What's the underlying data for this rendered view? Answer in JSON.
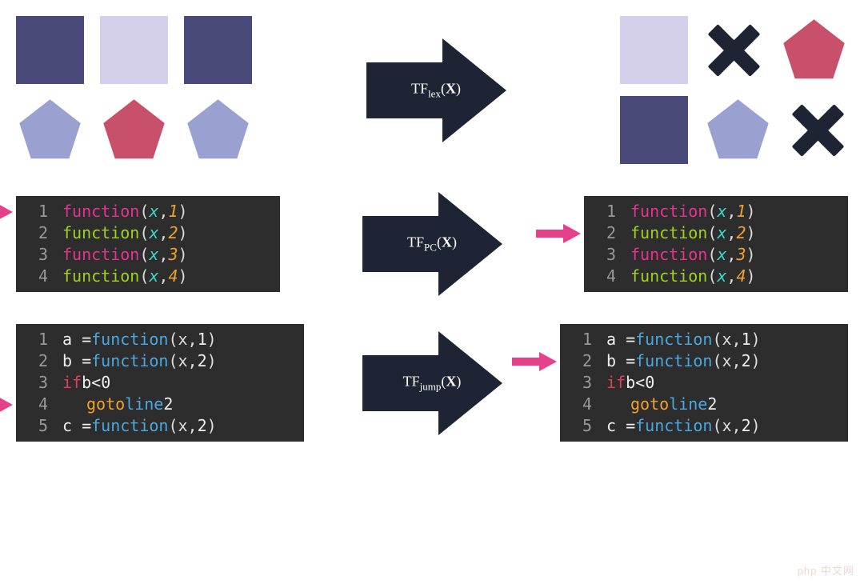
{
  "colors": {
    "darkPurple": "#4a4a7a",
    "lightLavender": "#d4d0ec",
    "bluePurple": "#9aa0d0",
    "rose": "#c8506a",
    "darkNavy": "#1e2433",
    "codeBg": "#2d2d2d",
    "arrowPink": "#e6408a"
  },
  "row1": {
    "label_prefix": "TF",
    "label_sub": "lex",
    "label_arg": "X",
    "left": {
      "top": [
        {
          "shape": "square",
          "color": "darkPurple"
        },
        {
          "shape": "square",
          "color": "lightLavender"
        },
        {
          "shape": "square",
          "color": "darkPurple"
        }
      ],
      "bottom": [
        {
          "shape": "pentagon",
          "color": "bluePurple"
        },
        {
          "shape": "pentagon",
          "color": "rose"
        },
        {
          "shape": "pentagon",
          "color": "bluePurple"
        }
      ]
    },
    "right": {
      "top": [
        {
          "shape": "square",
          "color": "lightLavender"
        },
        {
          "shape": "x",
          "color": "darkNavy"
        },
        {
          "shape": "pentagon",
          "color": "rose"
        }
      ],
      "bottom": [
        {
          "shape": "square",
          "color": "darkPurple"
        },
        {
          "shape": "pentagon",
          "color": "bluePurple"
        },
        {
          "shape": "x",
          "color": "darkNavy"
        }
      ]
    }
  },
  "row2": {
    "label_prefix": "TF",
    "label_sub": "PC",
    "label_arg": "X",
    "left_pointer_line": 1,
    "right_pointer_line": 2,
    "left_code": [
      {
        "n": "1",
        "fn_color": "pink",
        "fn": "function",
        "var": "x",
        "var_style": "teal",
        "arg": "1",
        "arg_style": "orange"
      },
      {
        "n": "2",
        "fn_color": "green",
        "fn": "function",
        "var": "x",
        "var_style": "teal",
        "arg": "2",
        "arg_style": "orange"
      },
      {
        "n": "3",
        "fn_color": "pink",
        "fn": "function",
        "var": "x",
        "var_style": "teal",
        "arg": "3",
        "arg_style": "orange"
      },
      {
        "n": "4",
        "fn_color": "green",
        "fn": "function",
        "var": "x",
        "var_style": "teal",
        "arg": "4",
        "arg_style": "orange"
      }
    ],
    "right_code": [
      {
        "n": "1",
        "fn_color": "pink",
        "fn": "function",
        "var": "x",
        "var_style": "teal",
        "arg": "1",
        "arg_style": "orange"
      },
      {
        "n": "2",
        "fn_color": "green",
        "fn": "function",
        "var": "x",
        "var_style": "teal",
        "arg": "2",
        "arg_style": "orange"
      },
      {
        "n": "3",
        "fn_color": "pink",
        "fn": "function",
        "var": "x",
        "var_style": "teal",
        "arg": "3",
        "arg_style": "orange"
      },
      {
        "n": "4",
        "fn_color": "green",
        "fn": "function",
        "var": "x",
        "var_style": "teal",
        "arg": "4",
        "arg_style": "orange"
      }
    ]
  },
  "row3": {
    "label_prefix": "TF",
    "label_sub": "jump",
    "label_arg": "X",
    "left_pointer_line": 4,
    "right_pointer_line": 2,
    "left_code": [
      {
        "n": "1",
        "type": "assign",
        "lhs": "a",
        "fn": "function",
        "var": "x",
        "arg": "1"
      },
      {
        "n": "2",
        "type": "assign",
        "lhs": "b",
        "fn": "function",
        "var": "x",
        "arg": "2"
      },
      {
        "n": "3",
        "type": "if",
        "cond_lhs": "b",
        "cond_op": "<",
        "cond_rhs": "0"
      },
      {
        "n": "4",
        "type": "goto",
        "kw": "goto",
        "target_kw": "line",
        "target": "2"
      },
      {
        "n": "5",
        "type": "assign",
        "lhs": "c",
        "fn": "function",
        "var": "x",
        "arg": "2"
      }
    ],
    "right_code": [
      {
        "n": "1",
        "type": "assign",
        "lhs": "a",
        "fn": "function",
        "var": "x",
        "arg": "1"
      },
      {
        "n": "2",
        "type": "assign",
        "lhs": "b",
        "fn": "function",
        "var": "x",
        "arg": "2"
      },
      {
        "n": "3",
        "type": "if",
        "cond_lhs": "b",
        "cond_op": "<",
        "cond_rhs": "0"
      },
      {
        "n": "4",
        "type": "goto",
        "kw": "goto",
        "target_kw": "line",
        "target": "2"
      },
      {
        "n": "5",
        "type": "assign",
        "lhs": "c",
        "fn": "function",
        "var": "x",
        "arg": "2"
      }
    ]
  },
  "watermark": "php 中文网"
}
